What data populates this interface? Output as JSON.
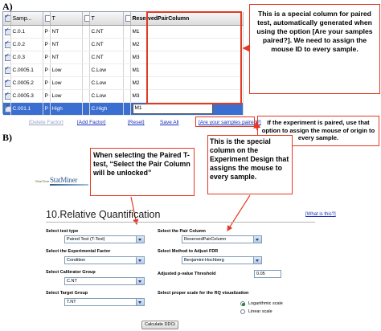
{
  "section_a": {
    "letter": "A)",
    "columns": [
      "Samp...",
      "T",
      "T",
      "ReservedPairColumn"
    ],
    "rows": [
      {
        "sample": "C.0.1",
        "c2": "P C",
        "c3": "NT",
        "c4": "C.NT",
        "pair": "M1",
        "checked": true
      },
      {
        "sample": "C.0.2",
        "c2": "P C",
        "c3": "NT",
        "c4": "C.NT",
        "pair": "M2",
        "checked": true
      },
      {
        "sample": "C.0.3",
        "c2": "P C",
        "c3": "NT",
        "c4": "C.NT",
        "pair": "M3",
        "checked": true
      },
      {
        "sample": "C.0005.1",
        "c2": "P C",
        "c3": "Low",
        "c4": "C.Low",
        "pair": "M1",
        "checked": true
      },
      {
        "sample": "C.0005.2",
        "c2": "P C",
        "c3": "Low",
        "c4": "C.Low",
        "pair": "M2",
        "checked": true
      },
      {
        "sample": "C.0005.3",
        "c2": "P C",
        "c3": "Low",
        "c4": "C.Low",
        "pair": "M3",
        "checked": true
      },
      {
        "sample": "C.001.1",
        "c2": "P C",
        "c3": "High",
        "c4": "C.High",
        "pair": "M1",
        "checked": true,
        "selected": true
      }
    ],
    "links": {
      "delete_factor": "[Delete Factor]",
      "add_factor": "[Add Factor]",
      "reset": "[Reset]",
      "save_all": "Save All",
      "paired": "[Are your samples paired?]"
    },
    "callout_top": "This is a special column for paired test, automatically generated when using the option [Are your samples paired?]. We need to assign the mouse ID to every sample.",
    "callout_bottom": "If the experiment is paired, use that option to assign the mouse of origin to every sample."
  },
  "section_b": {
    "letter": "B)",
    "callout_left": "When selecting the Paired T-test, “Select the Pair Column will be unlocked”",
    "callout_right": "This is the special column on the Experiment Design that assigns the mouse to every sample.",
    "logo": {
      "small": "RealTime",
      "main": "StatMiner"
    },
    "title": "10.Relative Quantification",
    "what_is": "[What is this?]",
    "left_fields": [
      {
        "label": "Select test type",
        "value": "Paired Test (T-Test)"
      },
      {
        "label": "Select the Experimental Factor",
        "value": "Condition"
      },
      {
        "label": "Select Calibrator Group",
        "value": "C.NT"
      },
      {
        "label": "Select Target Group",
        "value": "T.NT"
      }
    ],
    "right_fields": {
      "pair_label": "Select the Pair Column",
      "pair_value": "ReservedPairColumn",
      "fdr_label": "Select Method to Adjust FDR",
      "fdr_value": "Benjamini-Hochberg",
      "pval_label": "Adjusted p-value Threshold",
      "pval_value": "0.05",
      "scale_label": "Select proper scale for the RQ visualization",
      "scale_options": [
        "Logarithmic scale",
        "Linear scale"
      ],
      "scale_selected": "Logarithmic scale"
    },
    "button": "Calculate DDCt"
  },
  "colors": {
    "callout_border": "#e23a24",
    "selected_row": "#3a6fd1",
    "link": "#1b2fb8"
  }
}
